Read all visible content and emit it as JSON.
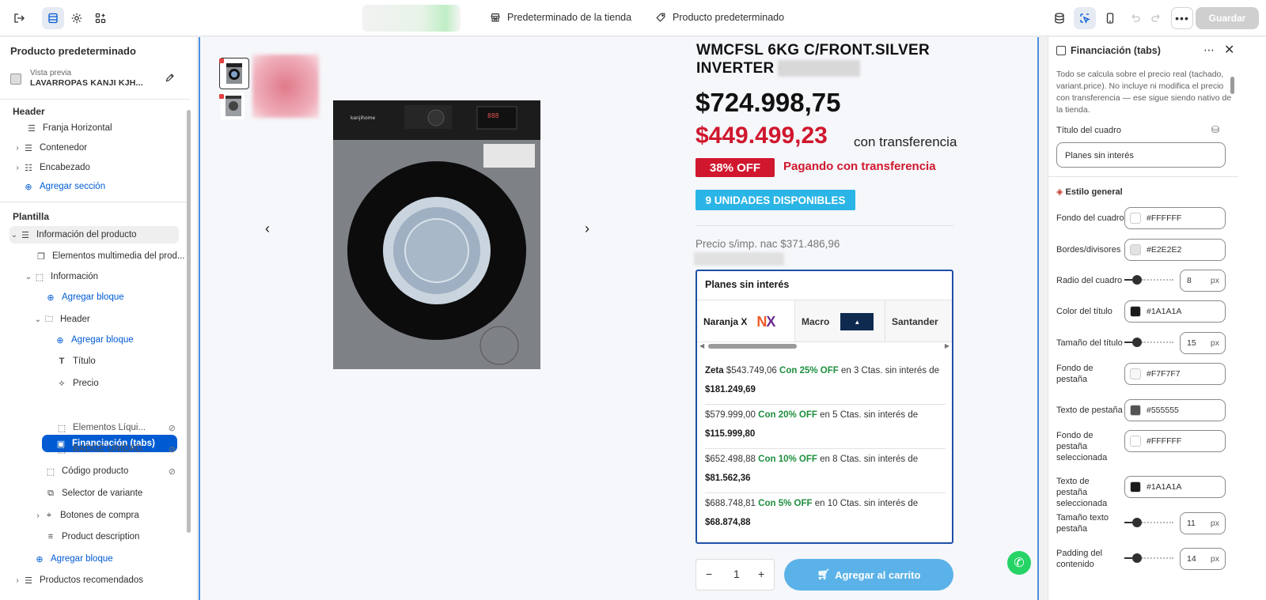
{
  "topbar": {
    "store_default": "Predeterminado de la tienda",
    "product_default": "Producto predeterminado",
    "save_label": "Guardar"
  },
  "left_panel": {
    "title": "Producto predeterminado",
    "preview_label": "Vista previa",
    "preview_value": "LAVARROPAS KANJI KJH...",
    "header_section": "Header",
    "header_items": [
      "Franja Horizontal",
      "Contenedor",
      "Encabezado"
    ],
    "add_section": "Agregar sección",
    "template_section": "Plantilla",
    "product_info": "Información del producto",
    "media_elements": "Elementos multimedia del prod...",
    "information": "Información",
    "add_block": "Agregar bloque",
    "header_group": "Header",
    "add_block_2": "Agregar bloque",
    "title_item": "Título",
    "price_item": "Precio",
    "financing_item": "Financiación (tabs)",
    "liquid_item": "Elementos Líqui...",
    "badge_item": "BADGE UNIDAD...",
    "code_item": "Código producto",
    "variant_item": "Selector de variante",
    "buy_buttons": "Botones de compra",
    "description_item": "Product description",
    "add_block_3": "Agregar bloque",
    "recommended": "Productos recomendados"
  },
  "product": {
    "title": "WMCFSL 6KG C/FRONT.SILVER INVERTER -",
    "price": "$724.998,75",
    "transfer_price": "$449.499,23",
    "transfer_label": "con transferencia",
    "off_badge": "38% OFF",
    "off_text": "Pagando con transferencia",
    "stock_badge": "9 UNIDADES DISPONIBLES",
    "nac_price": "Precio s/imp. nac $371.486,96",
    "quantity": "1",
    "minus": "−",
    "plus": "+",
    "add_to_cart": "Agregar al carrito"
  },
  "financing": {
    "title": "Planes sin interés",
    "tabs": [
      "Naranja X",
      "Macro",
      "Santander"
    ],
    "plans": [
      {
        "brand": "Zeta",
        "price": "$543.749,06",
        "off": "Con 25% OFF",
        "text": "en 3 Ctas. sin interés de",
        "installment": "$181.249,69"
      },
      {
        "brand": "",
        "price": "$579.999,00",
        "off": "Con 20% OFF",
        "text": "en 5 Ctas. sin interés de",
        "installment": "$115.999,80"
      },
      {
        "brand": "",
        "price": "$652.498,88",
        "off": "Con 10% OFF",
        "text": "en 8 Ctas. sin interés de",
        "installment": "$81.562,36"
      },
      {
        "brand": "",
        "price": "$688.748,81",
        "off": "Con 5% OFF",
        "text": "en 10 Ctas. sin interés de",
        "installment": "$68.874,88"
      }
    ]
  },
  "right_panel": {
    "title": "Financiación (tabs)",
    "description": "Todo se calcula sobre el precio real (tachado, variant.price). No incluye ni modifica el precio con transferencia — ese sigue siendo nativo de la tienda.",
    "box_title_label": "Título del cuadro",
    "box_title_value": "Planes sin interés",
    "general_style": "Estilo general",
    "bg_label": "Fondo del cuadro",
    "bg_value": "#FFFFFF",
    "border_label": "Bordes/divisores",
    "border_value": "#E2E2E2",
    "radius_label": "Radio del cuadro",
    "radius_value": "8",
    "title_color_label": "Color del título",
    "title_color_value": "#1A1A1A",
    "title_size_label": "Tamaño del título",
    "title_size_value": "15",
    "tab_bg_label": "Fondo de pestaña",
    "tab_bg_value": "#F7F7F7",
    "tab_text_label": "Texto de pestaña",
    "tab_text_value": "#555555",
    "tab_sel_bg_label": "Fondo de pestaña seleccionada",
    "tab_sel_bg_value": "#FFFFFF",
    "tab_sel_text_label": "Texto de pestaña seleccionada",
    "tab_sel_text_value": "#1A1A1A",
    "tab_text_size_label": "Tamaño texto pestaña",
    "tab_text_size_value": "11",
    "padding_label": "Padding del contenido",
    "padding_value": "14",
    "unit": "px"
  },
  "colors": {
    "accent": "#005bd3",
    "sale_red": "#d0172e",
    "stock_blue": "#2bb5e6",
    "green": "#1e8e3e"
  }
}
